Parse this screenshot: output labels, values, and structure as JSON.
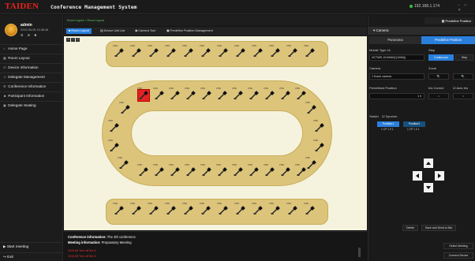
{
  "header": {
    "logo": "TAIDEN",
    "title": "Conference Management System",
    "ip": "192.168.1.174",
    "window_controls": "− □ ✕"
  },
  "user": {
    "name": "admin",
    "time": "2019-06-05 10:38:48",
    "icons": "⚙ ✉ ✖"
  },
  "sidebar": {
    "items": [
      {
        "label": "Home Page",
        "icon": "home-icon",
        "glyph": "⌂"
      },
      {
        "label": "Room Layout",
        "icon": "layout-icon",
        "glyph": "▦"
      },
      {
        "label": "Device Information",
        "icon": "device-icon",
        "glyph": "☷"
      },
      {
        "label": "Delegate Management",
        "icon": "delegate-icon",
        "glyph": "☺"
      },
      {
        "label": "Conference Information",
        "icon": "info-icon",
        "glyph": "☰"
      },
      {
        "label": "Participant Information",
        "icon": "participant-icon",
        "glyph": "☻"
      },
      {
        "label": "Delegate Seating",
        "icon": "seating-icon",
        "glyph": "▣"
      }
    ],
    "start_meeting": "Start meeting",
    "exit": "Exit"
  },
  "breadcrumb": "Room Layout > Room Layout",
  "tabs": [
    {
      "label": "Room Layout",
      "active": true
    },
    {
      "label": "Device Unit List",
      "active": false
    },
    {
      "label": "Camera Tool",
      "active": false
    },
    {
      "label": "Predefine Position Management",
      "active": false
    }
  ],
  "zoom_buttons": [
    "+",
    "−",
    "□"
  ],
  "mic_label": "0769",
  "info": {
    "conf_label": "Conference information:",
    "conf_value": "The 4th conference",
    "meeting_label": "Meeting information:",
    "meeting_value": "Preparatory Meeting",
    "log1": "2019-06 Turn off the A",
    "log2": "2019-06 Turn off the A"
  },
  "right": {
    "preset_button": "Predefine Position",
    "camera_header": "Camera",
    "seg_panorama": "Panorama",
    "seg_predefine": "Predefine Position",
    "mobile_type_label": "Mobile Type Ut",
    "mobile_type_value": "HCTWR-1010NW(1(100M))",
    "step_label": "Step",
    "step_continuous": "Continuous",
    "step_step": "Step",
    "camera_label": "Camera",
    "camera_value": "1 Dome camera",
    "zoom_label": "Zoom",
    "predefined_label": "Predefined Position",
    "predefined_value": "1",
    "iris_label": "Iris Control",
    "auto_iris": "Auto Iris",
    "switch_label": "Switch",
    "synchro_label": "Synchro",
    "position1": "Position1",
    "position2": "Position2",
    "pos1_sub": "1 CP 1 0 1",
    "pos2_sub": "1 CP 1 0 1",
    "delete": "Delete",
    "save_send": "Save and Send to Mic",
    "select_meeting": "Select Meeting",
    "connect_device": "Connect Device"
  },
  "colors": {
    "accent": "#2a7fdc",
    "brand": "#e8231c",
    "table": "#dcc47a",
    "canvas": "#f5f3de",
    "selected": "#e02424"
  }
}
